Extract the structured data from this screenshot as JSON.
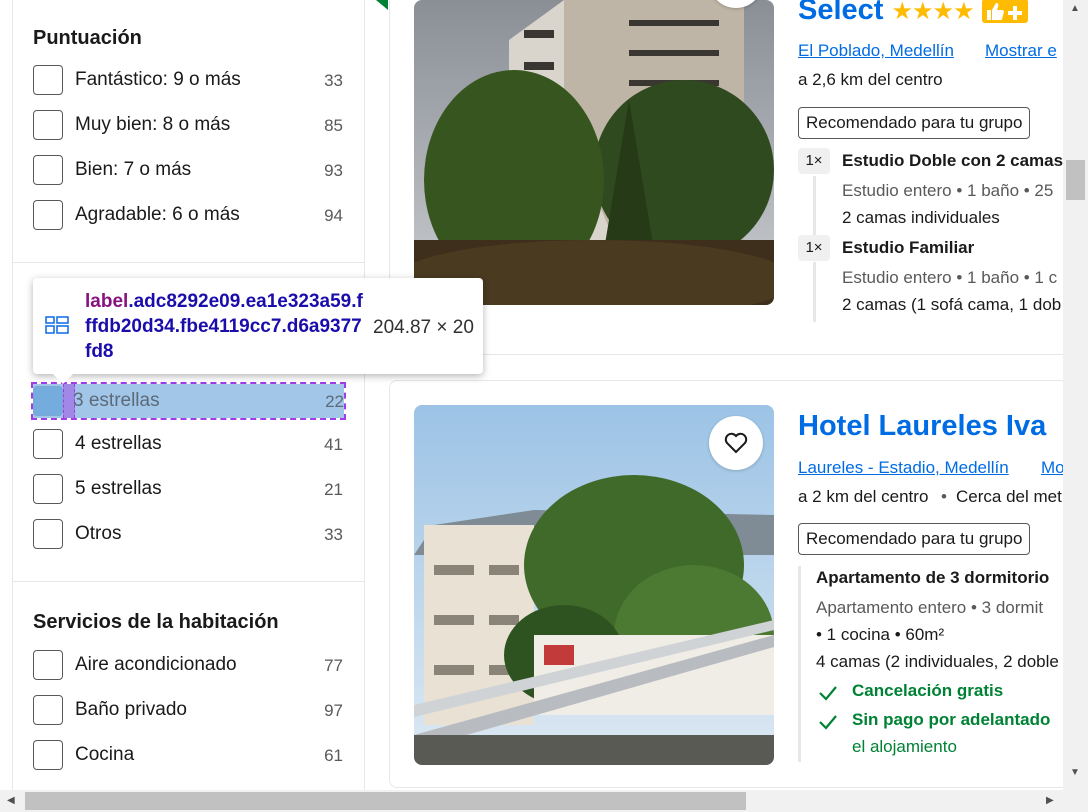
{
  "sidebar": {
    "rating_group": {
      "title": "Puntuación",
      "items": [
        {
          "label": "Fantástico: 9 o más",
          "count": "33"
        },
        {
          "label": "Muy bien: 8 o más",
          "count": "85"
        },
        {
          "label": "Bien: 7 o más",
          "count": "93"
        },
        {
          "label": "Agradable: 6 o más",
          "count": "94"
        }
      ]
    },
    "stars_group": {
      "items": [
        {
          "label": "3 estrellas",
          "count": "22"
        },
        {
          "label": "4 estrellas",
          "count": "41"
        },
        {
          "label": "5 estrellas",
          "count": "21"
        },
        {
          "label": "Otros",
          "count": "33"
        }
      ]
    },
    "room_group": {
      "title": "Servicios de la habitación",
      "items": [
        {
          "label": "Aire acondicionado",
          "count": "77"
        },
        {
          "label": "Baño privado",
          "count": "97"
        },
        {
          "label": "Cocina",
          "count": "61"
        }
      ]
    }
  },
  "tooltip": {
    "tag": "label",
    "selector": ".adc8292e09.ea1e323a59.fffdb20d34.fbe4119cc7.d6a9377fd8",
    "size": "204.87 × 20"
  },
  "hotels": [
    {
      "title": "Select",
      "stars": 4,
      "location": "El Poblado, Medellín",
      "map_link": "Mostrar e",
      "distance": "a 2,6 km del centro",
      "badge": "Recomendado para tu grupo",
      "rooms": [
        {
          "qty": "1×",
          "name": "Estudio Doble con 2 camas",
          "detail1": "Estudio entero • 1 baño • 25",
          "detail2": "2 camas individuales"
        },
        {
          "qty": "1×",
          "name": "Estudio Familiar",
          "detail1": "Estudio entero • 1 baño • 1 c",
          "detail2": "2 camas (1 sofá cama, 1 dob"
        }
      ]
    },
    {
      "title": "Hotel Laureles Iva",
      "location": "Laureles - Estadio, Medellín",
      "map_link": "Mo",
      "distance": "a 2 km del centro",
      "extra": "Cerca del met",
      "badge": "Recomendado para tu grupo",
      "room_name": "Apartamento de 3 dormitorio",
      "detail1": "Apartamento entero • 3 dormit",
      "detail2": "• 1 cocina • 60m²",
      "detail3": "4 camas (2 individuales, 2 doble",
      "benefit1": "Cancelación gratis",
      "benefit2": "Sin pago por adelantado",
      "benefit2_sub": "el alojamiento"
    }
  ],
  "colors": {
    "brand": "#006ce4",
    "success": "#008234",
    "star": "#febb02"
  }
}
